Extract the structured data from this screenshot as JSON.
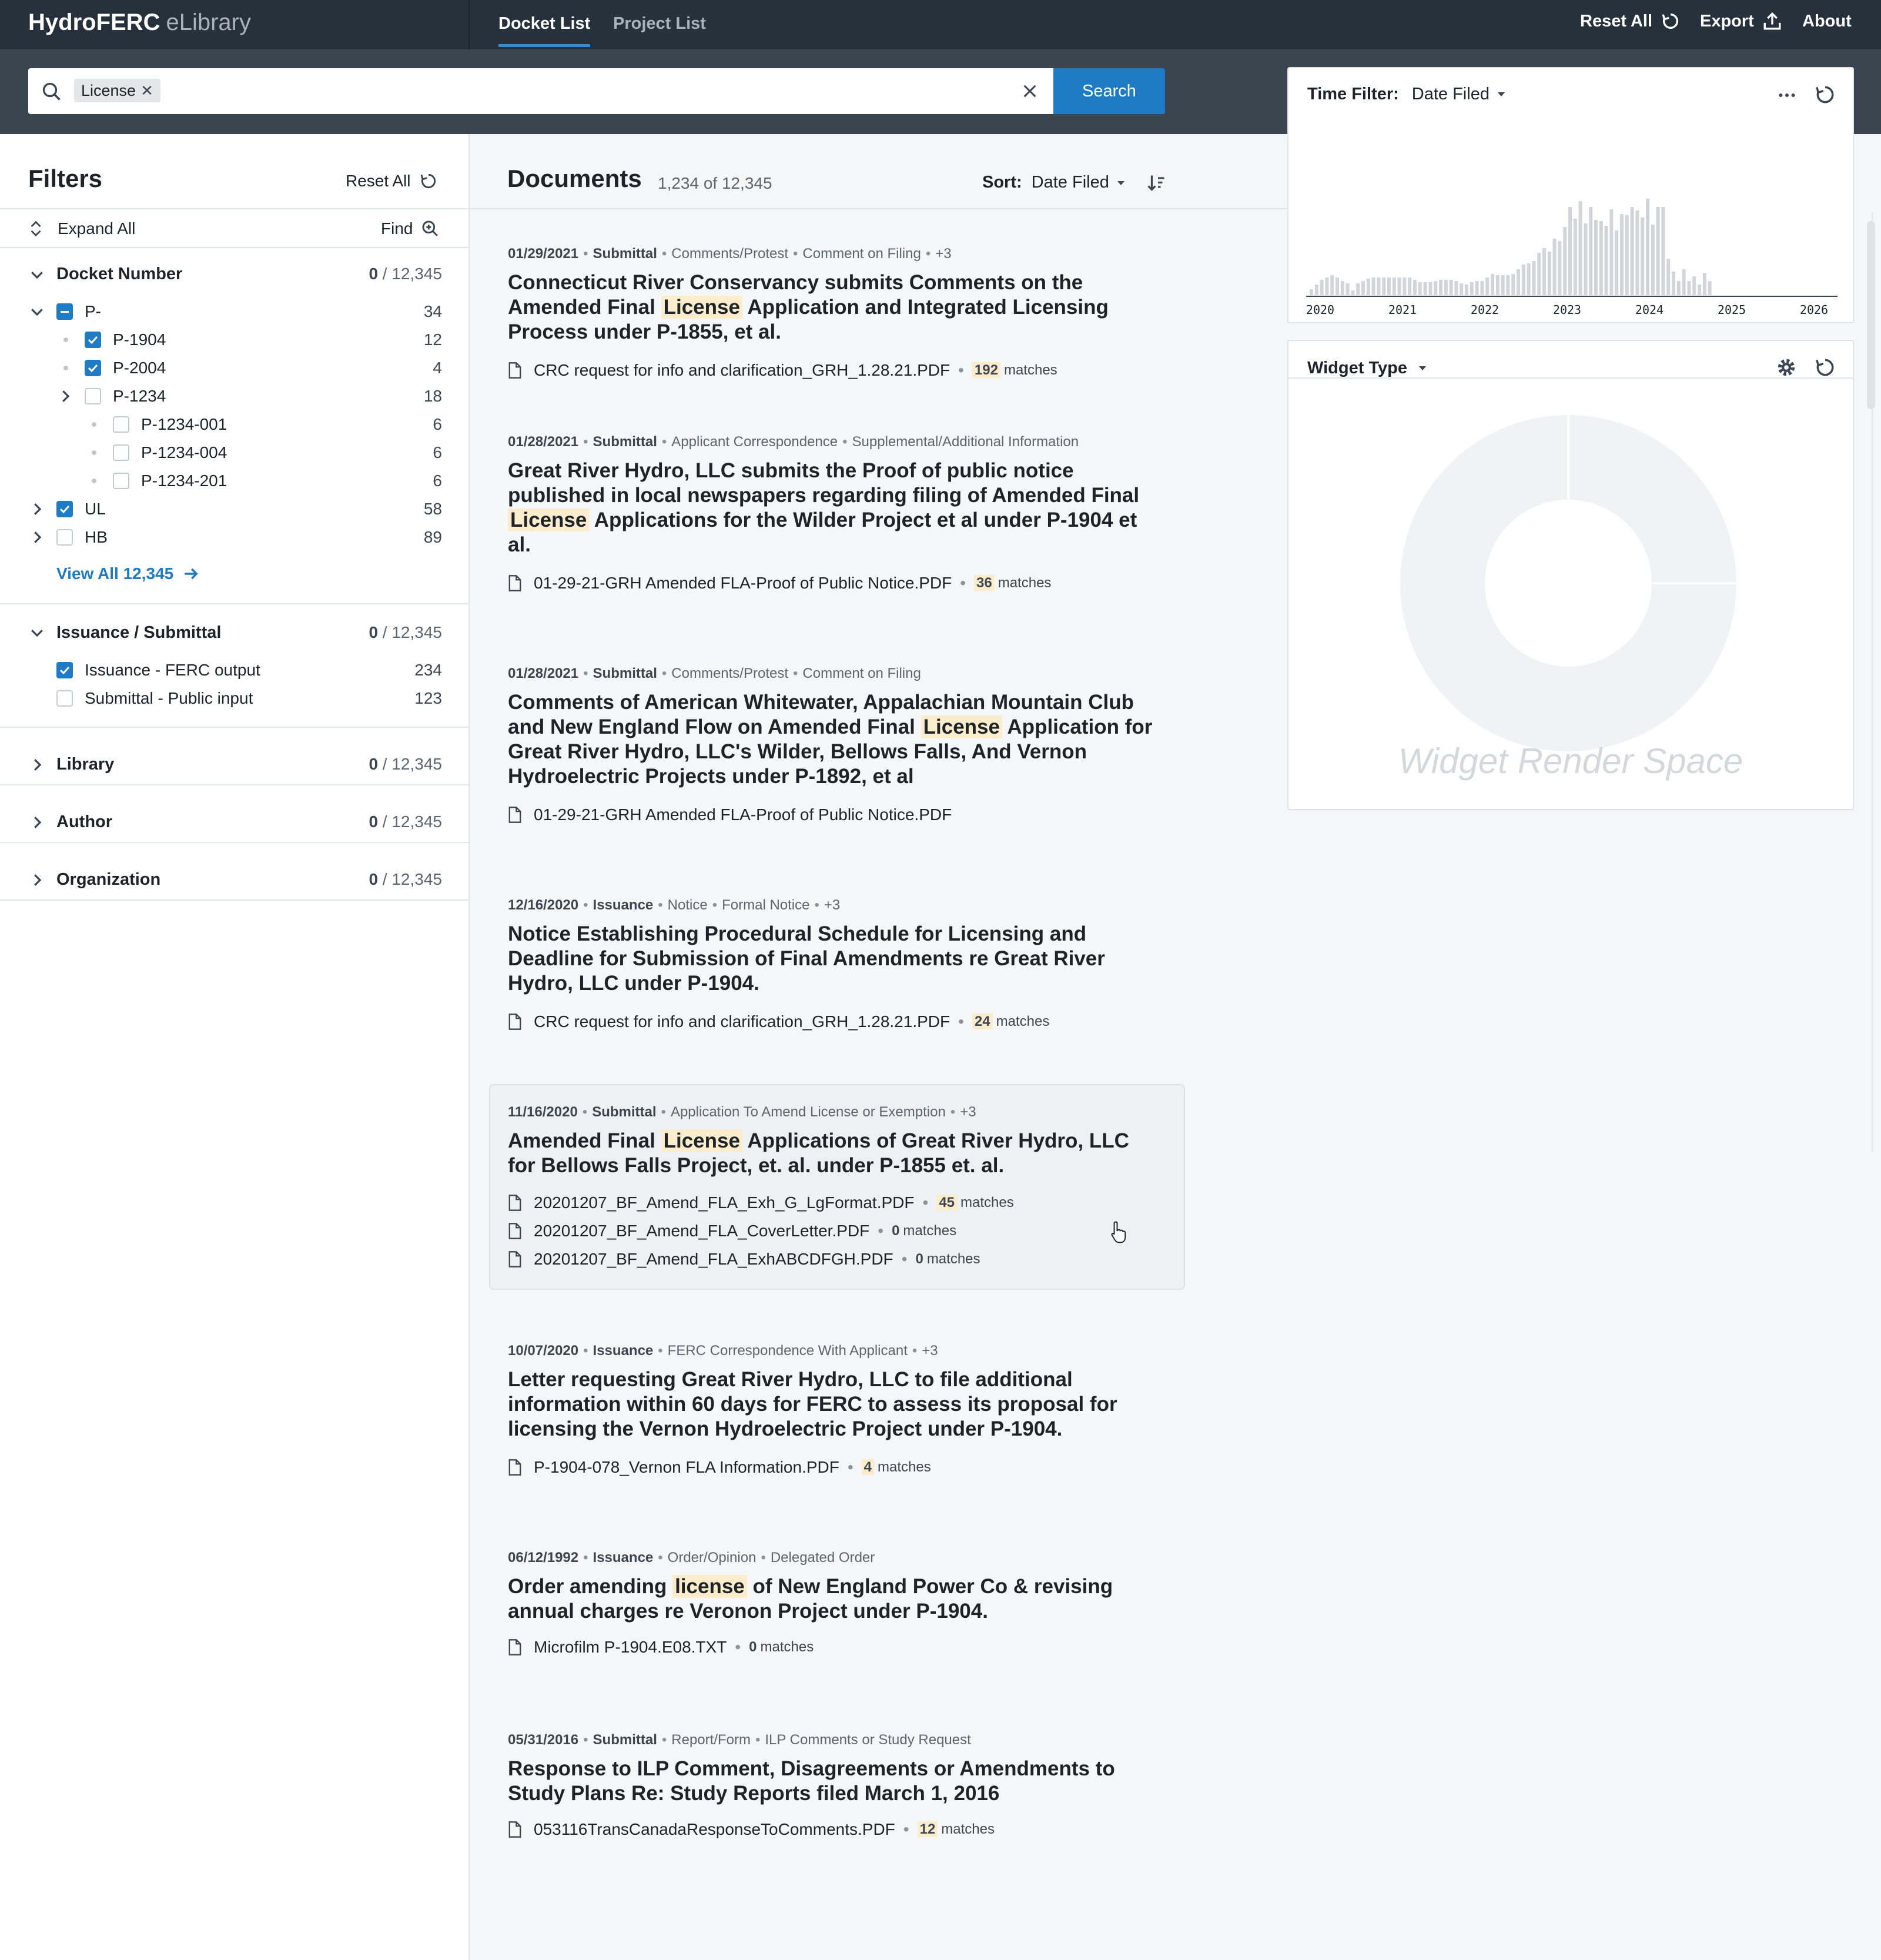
{
  "app": {
    "name": "HydroFERC",
    "sub": "eLibrary"
  },
  "nav": {
    "tabs": [
      "Docket List",
      "Project List"
    ],
    "active_tab": "Docket List"
  },
  "top_actions": {
    "reset": "Reset All",
    "export": "Export",
    "about": "About"
  },
  "search": {
    "chip": "License",
    "button": "Search"
  },
  "filters": {
    "title": "Filters",
    "reset": "Reset All",
    "expand": "Expand All",
    "find": "Find",
    "docket": {
      "label": "Docket Number",
      "sel": "0",
      "total": "/ 12,345",
      "items": [
        {
          "label": "P-",
          "count": "34"
        },
        {
          "label": "P-1904",
          "count": "12"
        },
        {
          "label": "P-2004",
          "count": "4"
        },
        {
          "label": "P-1234",
          "count": "18"
        },
        {
          "label": "P-1234-001",
          "count": "6"
        },
        {
          "label": "P-1234-004",
          "count": "6"
        },
        {
          "label": "P-1234-201",
          "count": "6"
        },
        {
          "label": "UL",
          "count": "58"
        },
        {
          "label": "HB",
          "count": "89"
        }
      ],
      "view_all": "View All 12,345"
    },
    "issuance": {
      "label": "Issuance / Submittal",
      "sel": "0",
      "total": "/ 12,345",
      "items": [
        {
          "label": "Issuance - FERC output",
          "count": "234"
        },
        {
          "label": "Submittal - Public input",
          "count": "123"
        }
      ]
    },
    "collapsed": [
      {
        "label": "Library",
        "sel": "0",
        "total": "/ 12,345"
      },
      {
        "label": "Author",
        "sel": "0",
        "total": "/ 12,345"
      },
      {
        "label": "Organization",
        "sel": "0",
        "total": "/ 12,345"
      }
    ]
  },
  "documents": {
    "title": "Documents",
    "count": "1,234 of 12,345",
    "sort_label": "Sort:",
    "sort_value": "Date Filed",
    "items": [
      {
        "date": "01/29/2021",
        "type": "Submittal",
        "cats": [
          "Comments/Protest",
          "Comment on Filing",
          "+3"
        ],
        "title_a": "Connecticut River Conservancy submits Comments on the Amended Final ",
        "title_hl": "License",
        "title_b": " Application and Integrated Licensing Process under P-1855, et al.",
        "files": [
          {
            "name": "CRC request for info and clarification_GRH_1.28.21.PDF",
            "matches": "192",
            "unit": "matches"
          }
        ]
      },
      {
        "date": "01/28/2021",
        "type": "Submittal",
        "cats": [
          "Applicant Correspondence",
          "Supplemental/Additional Information"
        ],
        "title_a": "Great River Hydro, LLC submits the Proof of public notice published in local newspapers regarding filing of Amended Final ",
        "title_hl": "License",
        "title_b": " Applications for the Wilder Project et al under P-1904 et al.",
        "files": [
          {
            "name": "01-29-21-GRH Amended FLA-Proof of Public Notice.PDF",
            "matches": "36",
            "unit": "matches"
          }
        ]
      },
      {
        "date": "01/28/2021",
        "type": "Submittal",
        "cats": [
          "Comments/Protest",
          "Comment on Filing"
        ],
        "title_a": "Comments of American Whitewater, Appalachian Mountain Club and New England Flow on Amended Final ",
        "title_hl": "License",
        "title_b": " Application for Great River Hydro, LLC's Wilder, Bellows Falls, And Vernon Hydroelectric Projects under P-1892, et al",
        "files": [
          {
            "name": "01-29-21-GRH Amended FLA-Proof of Public Notice.PDF",
            "matches": "",
            "unit": ""
          }
        ]
      },
      {
        "date": "12/16/2020",
        "type": "Issuance",
        "cats": [
          "Notice",
          "Formal Notice",
          "+3"
        ],
        "title_a": "Notice Establishing Procedural Schedule for Licensing and Deadline for Submission of Final Amendments re Great River Hydro, LLC under P-1904.",
        "title_hl": "",
        "title_b": "",
        "files": [
          {
            "name": "CRC request for info and clarification_GRH_1.28.21.PDF",
            "matches": "24",
            "unit": "matches"
          }
        ]
      },
      {
        "date": "11/16/2020",
        "type": "Submittal",
        "cats": [
          "Application To Amend License or Exemption",
          "+3"
        ],
        "title_a": "Amended Final ",
        "title_hl": "License",
        "title_b": " Applications of Great River Hydro, LLC for Bellows Falls Project, et. al. under P-1855 et. al.",
        "files": [
          {
            "name": "20201207_BF_Amend_FLA_Exh_G_LgFormat.PDF",
            "matches": "45",
            "unit": "matches"
          },
          {
            "name": "20201207_BF_Amend_FLA_CoverLetter.PDF",
            "matches": "0",
            "unit": "matches"
          },
          {
            "name": "20201207_BF_Amend_FLA_ExhABCDFGH.PDF",
            "matches": "0",
            "unit": "matches"
          }
        ]
      },
      {
        "date": "10/07/2020",
        "type": "Issuance",
        "cats": [
          "FERC Correspondence With Applicant",
          "+3"
        ],
        "title_a": "Letter requesting Great River Hydro, LLC to file additional information within 60 days for FERC to assess its proposal for licensing the Vernon Hydroelectric Project under P-1904.",
        "title_hl": "",
        "title_b": "",
        "files": [
          {
            "name": "P-1904-078_Vernon FLA Information.PDF",
            "matches": "4",
            "unit": "matches"
          }
        ]
      },
      {
        "date": "06/12/1992",
        "type": "Issuance",
        "cats": [
          "Order/Opinion",
          "Delegated Order"
        ],
        "title_a": "Order amending ",
        "title_hl": "license",
        "title_b": " of New England Power Co & revising annual charges re Veronon Project under P-1904.",
        "files": [
          {
            "name": "Microfilm P-1904.E08.TXT",
            "matches": "0",
            "unit": "matches"
          }
        ]
      },
      {
        "date": "05/31/2016",
        "type": "Submittal",
        "cats": [
          "Report/Form",
          "ILP Comments or Study Request"
        ],
        "title_a": "Response to ILP Comment, Disagreements or Amendments to Study Plans Re: Study Reports filed March 1, 2016",
        "title_hl": "",
        "title_b": "",
        "files": [
          {
            "name": "053116TransCanadaResponseToComments.PDF",
            "matches": "12",
            "unit": "matches"
          }
        ]
      }
    ]
  },
  "time_filter": {
    "label": "Time Filter:",
    "value": "Date Filed",
    "years": [
      "2020",
      "2021",
      "2022",
      "2023",
      "2024",
      "2025",
      "2026"
    ],
    "bar_color": "#d2d6da"
  },
  "widget": {
    "label": "Widget Type",
    "placeholder": "Widget Render Space"
  },
  "colors": {
    "accent": "#1f7bc4",
    "topbar": "#26313b",
    "highlight": "#fbedcb"
  }
}
